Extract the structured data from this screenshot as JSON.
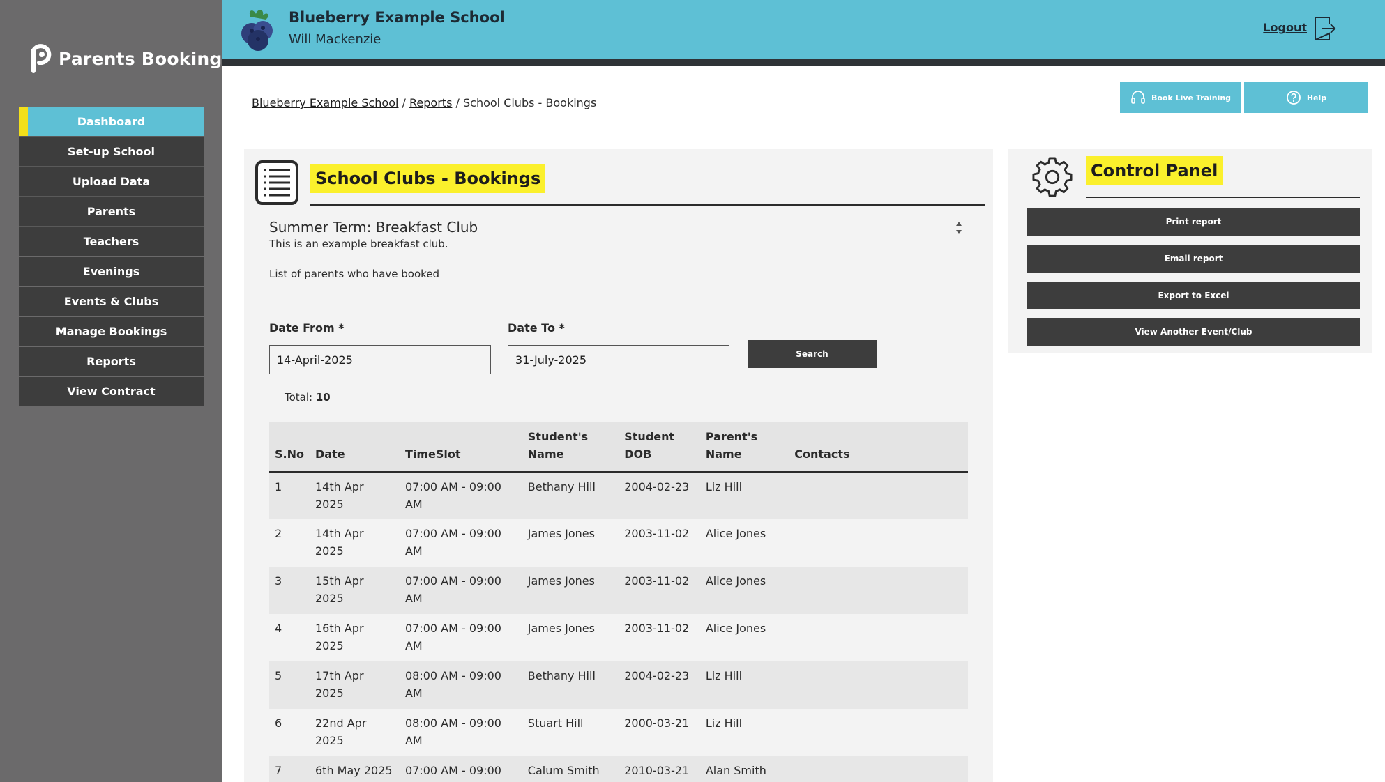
{
  "app": {
    "brand": "Parents Booking",
    "school_name": "Blueberry Example School",
    "user_name": "Will Mackenzie",
    "logout_label": "Logout"
  },
  "sidebar": {
    "items": [
      {
        "label": "Dashboard",
        "active": true
      },
      {
        "label": "Set-up School"
      },
      {
        "label": "Upload Data"
      },
      {
        "label": "Parents"
      },
      {
        "label": "Teachers"
      },
      {
        "label": "Evenings"
      },
      {
        "label": "Events & Clubs"
      },
      {
        "label": "Manage Bookings"
      },
      {
        "label": "Reports"
      },
      {
        "label": "View Contract"
      }
    ]
  },
  "breadcrumb": {
    "school": "Blueberry Example School",
    "separator": "/",
    "reports": "Reports",
    "current": "School Clubs - Bookings"
  },
  "top_buttons": {
    "training": "Book Live Training",
    "help": "Help"
  },
  "main": {
    "title": "School Clubs - Bookings",
    "club_name": "Summer Term: Breakfast Club",
    "club_description": "This is an example breakfast club.",
    "list_caption": "List of parents who have booked",
    "date_from_label": "Date From *",
    "date_from_value": "14-April-2025",
    "date_to_label": "Date To *",
    "date_to_value": "31-July-2025",
    "search_label": "Search",
    "total_label": "Total:",
    "total_value": "10"
  },
  "table": {
    "headers": [
      "S.No",
      "Date",
      "TimeSlot",
      "Student's Name",
      "Student DOB",
      "Parent's Name",
      "Contacts"
    ],
    "rows": [
      [
        "1",
        "14th Apr 2025",
        "07:00 AM - 09:00 AM",
        "Bethany Hill",
        "2004-02-23",
        "Liz Hill",
        ""
      ],
      [
        "2",
        "14th Apr 2025",
        "07:00 AM - 09:00 AM",
        "James Jones",
        "2003-11-02",
        "Alice Jones",
        ""
      ],
      [
        "3",
        "15th Apr 2025",
        "07:00 AM - 09:00 AM",
        "James Jones",
        "2003-11-02",
        "Alice Jones",
        ""
      ],
      [
        "4",
        "16th Apr 2025",
        "07:00 AM - 09:00 AM",
        "James Jones",
        "2003-11-02",
        "Alice Jones",
        ""
      ],
      [
        "5",
        "17th Apr 2025",
        "08:00 AM - 09:00 AM",
        "Bethany Hill",
        "2004-02-23",
        "Liz Hill",
        ""
      ],
      [
        "6",
        "22nd Apr 2025",
        "08:00 AM - 09:00 AM",
        "Stuart Hill",
        "2000-03-21",
        "Liz Hill",
        ""
      ],
      [
        "7",
        "6th May 2025",
        "07:00 AM - 09:00",
        "Calum Smith",
        "2010-03-21",
        "Alan Smith",
        ""
      ]
    ]
  },
  "control_panel": {
    "title": "Control Panel",
    "buttons": [
      "Print report",
      "Email report",
      "Export to Excel",
      "View Another Event/Club"
    ]
  },
  "colors": {
    "accent": "#5ec0d5",
    "highlight": "#fbf02c",
    "sidebar_bg": "#6b6a6b",
    "dark_button": "#3d3d3d"
  }
}
